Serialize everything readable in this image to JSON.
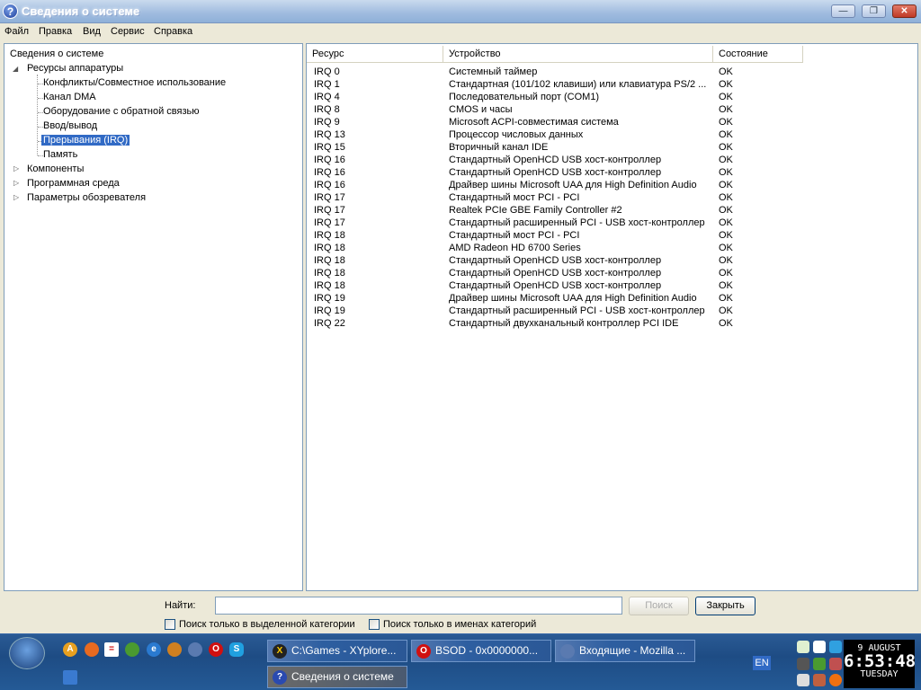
{
  "window": {
    "title": "Сведения о системе",
    "minimize": "—",
    "restore": "❐",
    "close": "✕"
  },
  "menu": [
    "Файл",
    "Правка",
    "Вид",
    "Сервис",
    "Справка"
  ],
  "tree": {
    "root": "Сведения о системе",
    "hardware": "Ресурсы аппаратуры",
    "children": [
      "Конфликты/Совместное использование",
      "Канал DMA",
      "Оборудование с обратной связью",
      "Ввод/вывод",
      "Прерывания (IRQ)",
      "Память"
    ],
    "selected_index": 4,
    "others": [
      "Компоненты",
      "Программная среда",
      "Параметры обозревателя"
    ]
  },
  "table": {
    "headers": [
      "Ресурс",
      "Устройство",
      "Состояние"
    ],
    "rows": [
      [
        "IRQ 0",
        "Системный таймер",
        "OK"
      ],
      [
        "IRQ 1",
        "Стандартная (101/102 клавиши) или клавиатура PS/2 ...",
        "OK"
      ],
      [
        "IRQ 4",
        "Последовательный порт (COM1)",
        "OK"
      ],
      [
        "IRQ 8",
        "CMOS и часы",
        "OK"
      ],
      [
        "IRQ 9",
        "Microsoft ACPI-совместимая система",
        "OK"
      ],
      [
        "IRQ 13",
        "Процессор числовых данных",
        "OK"
      ],
      [
        "IRQ 15",
        "Вторичный канал IDE",
        "OK"
      ],
      [
        "IRQ 16",
        "Стандартный OpenHCD USB хост-контроллер",
        "OK"
      ],
      [
        "IRQ 16",
        "Стандартный OpenHCD USB хост-контроллер",
        "OK"
      ],
      [
        "IRQ 16",
        "Драйвер шины Microsoft UAA для High Definition Audio",
        "OK"
      ],
      [
        "IRQ 17",
        "Стандартный мост PCI - PCI",
        "OK"
      ],
      [
        "IRQ 17",
        "Realtek PCIe GBE Family Controller #2",
        "OK"
      ],
      [
        "IRQ 17",
        "Стандартный расширенный PCI - USB хост-контроллер",
        "OK"
      ],
      [
        "IRQ 18",
        "Стандартный мост PCI - PCI",
        "OK"
      ],
      [
        "IRQ 18",
        "AMD Radeon HD 6700 Series",
        "OK"
      ],
      [
        "IRQ 18",
        "Стандартный OpenHCD USB хост-контроллер",
        "OK"
      ],
      [
        "IRQ 18",
        "Стандартный OpenHCD USB хост-контроллер",
        "OK"
      ],
      [
        "IRQ 18",
        "Стандартный OpenHCD USB хост-контроллер",
        "OK"
      ],
      [
        "IRQ 19",
        "Драйвер шины Microsoft UAA для High Definition Audio",
        "OK"
      ],
      [
        "IRQ 19",
        "Стандартный расширенный PCI - USB хост-контроллер",
        "OK"
      ],
      [
        "IRQ 22",
        "Стандартный двухканальный контроллер PCI IDE",
        "OK"
      ]
    ]
  },
  "find": {
    "label": "Найти:",
    "value": "",
    "search_button": "Поиск",
    "close_button": "Закрыть",
    "check1": "Поиск только в выделенной категории",
    "check2": "Поиск только в именах категорий"
  },
  "taskbar": {
    "tasks": [
      "C:\\Games - XYplore...",
      "BSOD - 0x0000000...",
      "Входящие - Mozilla ...",
      "Сведения о системе"
    ],
    "language": "EN",
    "clock": {
      "date": "9 AUGUST",
      "time": "6:53:48",
      "day": "TUESDAY"
    }
  }
}
